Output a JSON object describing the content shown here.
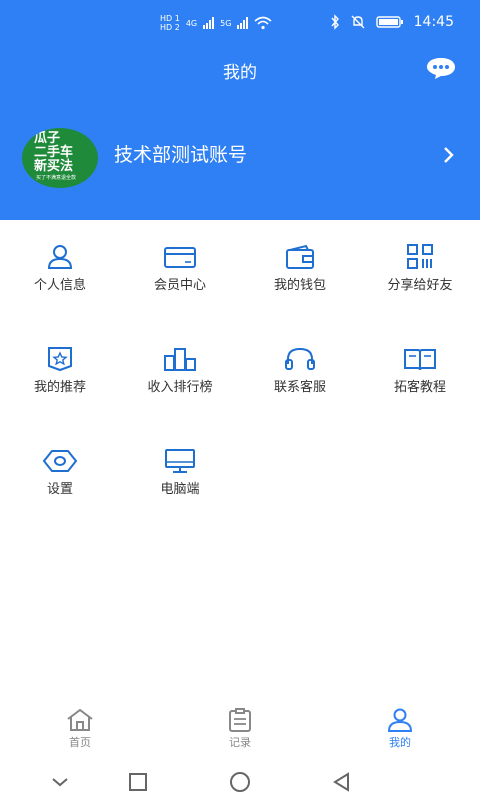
{
  "status_bar": {
    "sim1": "HD 1",
    "sim2": "HD 2",
    "net1": "4G",
    "net2": "5G",
    "time": "14:45"
  },
  "header": {
    "title": "我的",
    "chat_icon": "chat-bubble-icon",
    "avatar_lines": [
      "瓜子",
      "二手车",
      "新买法",
      "买了不满意退全款"
    ],
    "username": "技术部测试账号"
  },
  "menu": [
    {
      "label": "个人信息",
      "icon": "person-icon"
    },
    {
      "label": "会员中心",
      "icon": "vip-card-icon"
    },
    {
      "label": "我的钱包",
      "icon": "wallet-icon"
    },
    {
      "label": "分享给好友",
      "icon": "qr-code-icon"
    },
    {
      "label": "我的推荐",
      "icon": "star-badge-icon"
    },
    {
      "label": "收入排行榜",
      "icon": "ranking-icon"
    },
    {
      "label": "联系客服",
      "icon": "headset-icon"
    },
    {
      "label": "拓客教程",
      "icon": "book-icon"
    },
    {
      "label": "设置",
      "icon": "settings-icon"
    },
    {
      "label": "电脑端",
      "icon": "monitor-icon"
    }
  ],
  "tabs": [
    {
      "label": "首页",
      "icon": "home-icon",
      "active": false
    },
    {
      "label": "记录",
      "icon": "clipboard-icon",
      "active": false
    },
    {
      "label": "我的",
      "icon": "user-icon",
      "active": true
    }
  ],
  "colors": {
    "primary": "#2f80f4",
    "icon_blue": "#1f6fd1",
    "text": "#333333",
    "tab_inactive": "#888888",
    "tab_active": "#2f80f4",
    "avatar_green": "#1f8a3a"
  }
}
